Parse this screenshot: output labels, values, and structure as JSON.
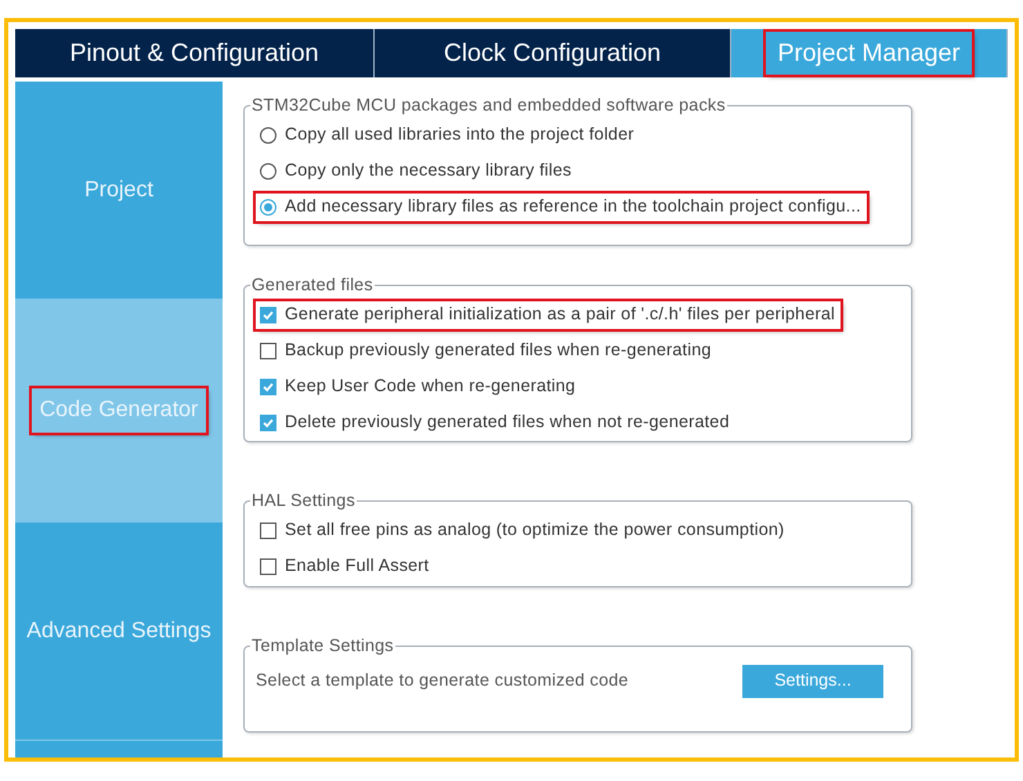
{
  "tabs": [
    {
      "label": "Pinout & Configuration",
      "selected": false,
      "highlighted": false
    },
    {
      "label": "Clock Configuration",
      "selected": false,
      "highlighted": false
    },
    {
      "label": "Project Manager",
      "selected": true,
      "highlighted": true
    }
  ],
  "sidebar": {
    "items": [
      {
        "label": "Project",
        "selected": false,
        "highlighted": false
      },
      {
        "label": "Code Generator",
        "selected": true,
        "highlighted": true
      },
      {
        "label": "Advanced Settings",
        "selected": false,
        "highlighted": false
      }
    ]
  },
  "groups": [
    {
      "kind": "options",
      "title": "STM32Cube MCU packages and embedded software packs",
      "options": [
        {
          "kind": "radio",
          "label": "Copy all used libraries into the project folder",
          "selected": false,
          "highlighted": false
        },
        {
          "kind": "radio",
          "label": "Copy only the necessary library files",
          "selected": false,
          "highlighted": false
        },
        {
          "kind": "radio",
          "label": "Add necessary library files as reference in the toolchain project configu...",
          "selected": true,
          "highlighted": true
        }
      ]
    },
    {
      "kind": "options",
      "title": "Generated files",
      "options": [
        {
          "kind": "checkbox",
          "label": "Generate peripheral initialization as a pair of '.c/.h' files per peripheral",
          "checked": true,
          "highlighted": true
        },
        {
          "kind": "checkbox",
          "label": "Backup previously generated files when re-generating",
          "checked": false,
          "highlighted": false
        },
        {
          "kind": "checkbox",
          "label": "Keep User Code when re-generating",
          "checked": true,
          "highlighted": false
        },
        {
          "kind": "checkbox",
          "label": "Delete previously generated files when not re-generated",
          "checked": true,
          "highlighted": false
        }
      ]
    },
    {
      "kind": "options",
      "title": "HAL Settings",
      "options": [
        {
          "kind": "checkbox",
          "label": "Set all free pins as analog (to optimize the power consumption)",
          "checked": false,
          "highlighted": false
        },
        {
          "kind": "checkbox",
          "label": "Enable Full Assert",
          "checked": false,
          "highlighted": false
        }
      ]
    },
    {
      "kind": "template",
      "title": "Template Settings",
      "description": "Select a template to generate customized code",
      "button": "Settings..."
    }
  ]
}
